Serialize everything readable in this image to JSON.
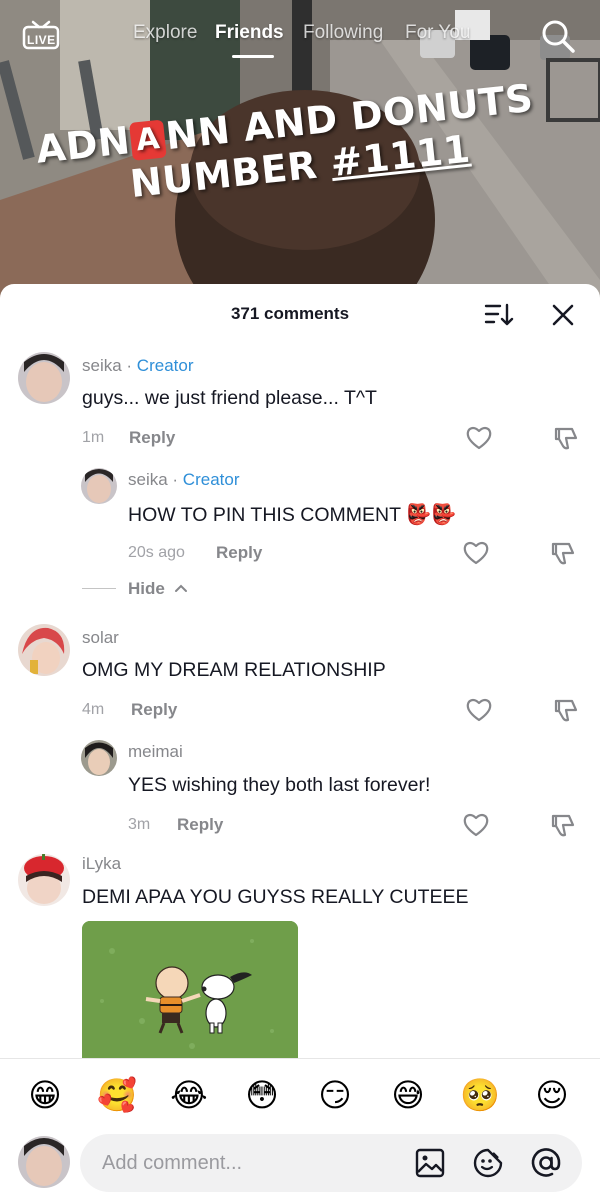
{
  "top_nav": {
    "live_label": "LIVE",
    "tabs": [
      "Explore",
      "Friends",
      "Following",
      "For You"
    ],
    "active_tab": "Friends"
  },
  "video": {
    "title_line1_a": "ADN",
    "title_badge": "A",
    "title_line1_b": "NN AND DONUTS",
    "title_line2_a": "NUMBER ",
    "title_line2_b": "#1111"
  },
  "sheet": {
    "comments_count": "371 comments"
  },
  "comments": [
    {
      "user": "seika",
      "separator": " · ",
      "badge": "Creator",
      "text": "guys... we just friend please... T^T",
      "time": "1m",
      "reply": "Reply"
    },
    {
      "user": "seika",
      "separator": " · ",
      "badge": "Creator",
      "text": "HOW TO PIN THIS COMMENT",
      "emoji": "👺👺",
      "time": "20s ago",
      "reply": "Reply"
    },
    {
      "user": "solar",
      "text": "OMG MY DREAM RELATIONSHIP",
      "time": "4m",
      "reply": "Reply"
    },
    {
      "user": "meimai",
      "text": "YES wishing they both last forever!",
      "time": "3m",
      "reply": "Reply"
    },
    {
      "user": "iLyka",
      "text": "DEMI APAA YOU GUYSS REALLY CUTEEE"
    }
  ],
  "hide_label": "Hide",
  "emoji_bar": [
    "😁",
    "🥰",
    "😂",
    "😳",
    "😏",
    "😅",
    "🥺",
    "😌"
  ],
  "input": {
    "placeholder": "Add comment..."
  },
  "colors": {
    "creator": "#2f8fd8",
    "text": "#161823",
    "muted": "#86878b"
  }
}
